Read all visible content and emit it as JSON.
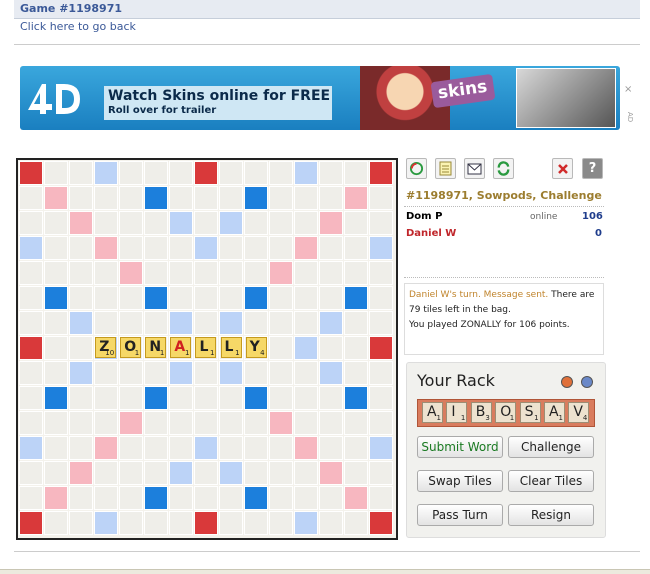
{
  "header": {
    "title": "Game #1198971",
    "back_link": "Click here to go back"
  },
  "ad": {
    "headline": "Watch Skins online for FREE",
    "subline": "Roll over for trailer",
    "brand": "skins",
    "close_icon": "×",
    "ad_marker": "AD"
  },
  "board": {
    "played_word": [
      {
        "letter": "Z",
        "score": "10"
      },
      {
        "letter": "O",
        "score": "1"
      },
      {
        "letter": "N",
        "score": "1"
      },
      {
        "letter": "A",
        "score": "1"
      },
      {
        "letter": "L",
        "score": "1"
      },
      {
        "letter": "L",
        "score": "1"
      },
      {
        "letter": "Y",
        "score": "4"
      }
    ]
  },
  "toolbar": {
    "icons": [
      "disc-icon",
      "notepad-icon",
      "envelope-icon",
      "refresh-icon",
      "close-icon",
      "help-icon"
    ]
  },
  "game_info": "#1198971, Sowpods, Challenge",
  "players": [
    {
      "name": "Dom P",
      "status": "online",
      "score": "106",
      "color": "#000000"
    },
    {
      "name": "Daniel W",
      "status": "",
      "score": "0",
      "color": "#c0262b"
    }
  ],
  "message": {
    "highlight": "Daniel W's turn. Message sent.",
    "line1_rest": " There are 79 tiles left in the bag.",
    "line2": "You played ZONALLY for 106 points."
  },
  "rack": {
    "title": "Your Rack",
    "tiles": [
      {
        "letter": "A",
        "score": "1"
      },
      {
        "letter": "I",
        "score": "1"
      },
      {
        "letter": "B",
        "score": "3"
      },
      {
        "letter": "O",
        "score": "1"
      },
      {
        "letter": "S",
        "score": "1"
      },
      {
        "letter": "A",
        "score": "1"
      },
      {
        "letter": "V",
        "score": "4"
      }
    ]
  },
  "buttons": {
    "submit": "Submit Word",
    "challenge": "Challenge",
    "swap": "Swap Tiles",
    "clear": "Clear Tiles",
    "pass": "Pass Turn",
    "resign": "Resign"
  },
  "colors": {
    "accent": "#3b5998",
    "info": "#9c7d2f",
    "opponent": "#c0262b"
  }
}
